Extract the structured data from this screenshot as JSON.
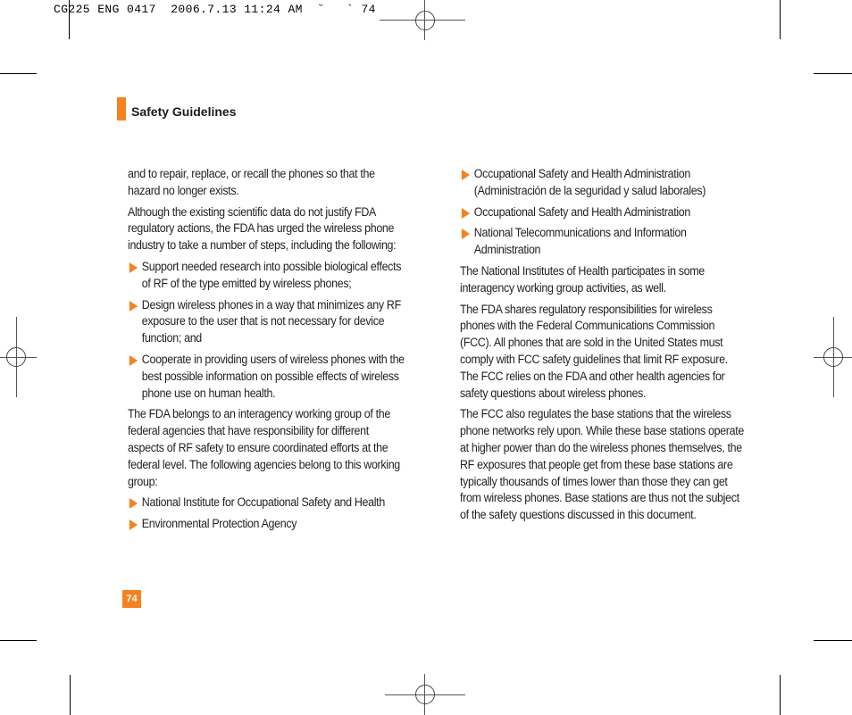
{
  "slug": {
    "text": "CG225 ENG 0417  2006.7.13 11:24 AM  ˘   ` 74"
  },
  "header": {
    "section_title": "Safety Guidelines",
    "accent_color": "#f5821f"
  },
  "left_column": {
    "blocks": [
      {
        "type": "para",
        "text": "and to repair, replace, or recall the phones so that the hazard no longer exists."
      },
      {
        "type": "para",
        "text": "Although the existing scientific data do not justify FDA regulatory actions, the FDA has urged the wireless phone industry to take a number of steps, including the following:"
      },
      {
        "type": "bullet",
        "text": "Support needed research into possible biological effects of RF of the type emitted by wireless phones;"
      },
      {
        "type": "bullet",
        "text": "Design wireless phones in a way that minimizes any RF exposure to the user that is not necessary for device function; and"
      },
      {
        "type": "bullet",
        "text": "Cooperate in providing users of wireless phones with the best possible information on possible effects of wireless phone use on human health."
      },
      {
        "type": "para",
        "text": "The FDA belongs to an interagency working group of the federal agencies that have responsibility for different aspects of RF safety to ensure coordinated efforts at the federal level. The following agencies belong to this working group:"
      },
      {
        "type": "bullet",
        "text": "National Institute for Occupational Safety and Health"
      },
      {
        "type": "bullet",
        "text": "Environmental Protection Agency"
      }
    ]
  },
  "right_column": {
    "blocks": [
      {
        "type": "bullet",
        "text": "Occupational Safety and Health Administration (Administración de la seguridad y salud laborales)"
      },
      {
        "type": "bullet",
        "text": "Occupational Safety and Health Administration"
      },
      {
        "type": "bullet",
        "text": "National Telecommunications and Information Administration"
      },
      {
        "type": "para",
        "text": "The National Institutes of Health participates in some interagency working group activities, as well."
      },
      {
        "type": "para",
        "text": "The FDA shares regulatory responsibilities for wireless phones with the Federal Communications Commission (FCC). All phones that are sold in the United States must comply with FCC safety guidelines that limit RF exposure. The FCC relies on the FDA and other health agencies for safety questions about wireless phones."
      },
      {
        "type": "para",
        "text": "The FCC also regulates the base stations that the wireless phone networks rely upon. While these base stations operate at higher power than do the wireless phones themselves, the RF exposures that people get from these base stations are typically thousands of times lower than those they can get from wireless phones. Base stations are thus not the subject of the safety questions discussed in this document."
      }
    ]
  },
  "footer": {
    "page_number": "74"
  }
}
